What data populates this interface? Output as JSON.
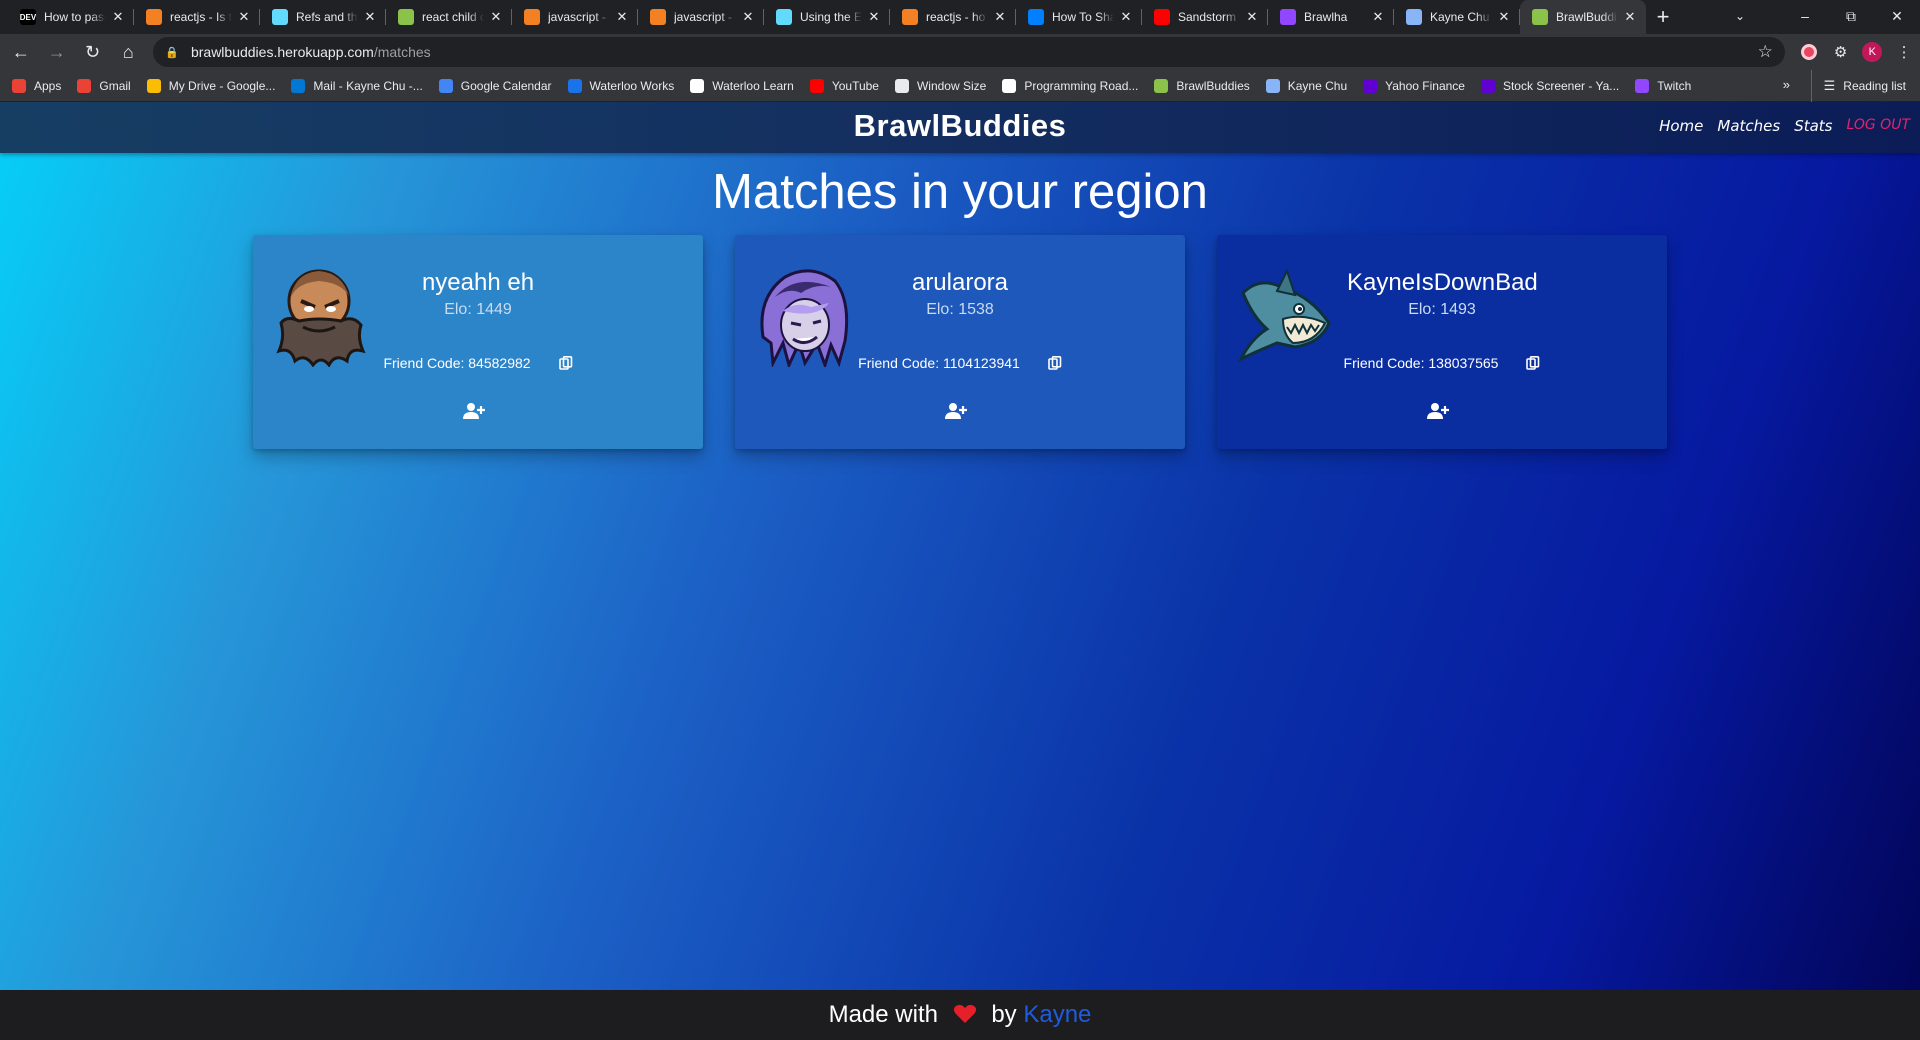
{
  "tabs": [
    {
      "title": "How to pass",
      "favicon": "DEV",
      "color": "#000000",
      "active": false
    },
    {
      "title": "reactjs - Is t",
      "favicon": "stackoverflow-icon",
      "color": "#f48024",
      "active": false
    },
    {
      "title": "Refs and th",
      "favicon": "react-icon",
      "color": "#61dafb",
      "active": false
    },
    {
      "title": "react child c",
      "favicon": "brawl-icon",
      "color": "#8bc34a",
      "active": false
    },
    {
      "title": "javascript - ",
      "favicon": "stackoverflow-icon",
      "color": "#f48024",
      "active": false
    },
    {
      "title": "javascript - ",
      "favicon": "stackoverflow-icon",
      "color": "#f48024",
      "active": false
    },
    {
      "title": "Using the E",
      "favicon": "react-icon",
      "color": "#61dafb",
      "active": false
    },
    {
      "title": "reactjs - ho",
      "favicon": "stackoverflow-icon",
      "color": "#f48024",
      "active": false
    },
    {
      "title": "How To Sha",
      "favicon": "digitalocean-icon",
      "color": "#0080ff",
      "active": false
    },
    {
      "title": "Sandstorm",
      "favicon": "youtube-icon",
      "color": "#ff0000",
      "active": false
    },
    {
      "title": "Brawlha",
      "favicon": "twitch-icon",
      "color": "#9146ff",
      "active": false
    },
    {
      "title": "Kayne Chu",
      "favicon": "globe-icon",
      "color": "#8ab4f8",
      "active": false
    },
    {
      "title": "BrawlBuddi",
      "favicon": "brawl-icon",
      "color": "#8bc34a",
      "active": true
    }
  ],
  "address": {
    "host": "brawlbuddies.herokuapp.com",
    "path": "/matches"
  },
  "profile_initial": "K",
  "bookmarks": [
    {
      "label": "Apps",
      "icon": "apps-grid-icon",
      "color": "#ea4335"
    },
    {
      "label": "Gmail",
      "icon": "gmail-icon",
      "color": "#ea4335"
    },
    {
      "label": "My Drive - Google...",
      "icon": "drive-icon",
      "color": "#fbbc04"
    },
    {
      "label": "Mail - Kayne Chu -...",
      "icon": "outlook-icon",
      "color": "#0078d4"
    },
    {
      "label": "Google Calendar",
      "icon": "calendar-icon",
      "color": "#4285f4"
    },
    {
      "label": "Waterloo Works",
      "icon": "waterloo-works-icon",
      "color": "#1a73e8"
    },
    {
      "label": "Waterloo Learn",
      "icon": "learn-icon",
      "color": "#ffffff"
    },
    {
      "label": "YouTube",
      "icon": "youtube-icon",
      "color": "#ff0000"
    },
    {
      "label": "Window Size",
      "icon": "globe-icon",
      "color": "#e8eaed"
    },
    {
      "label": "Programming Road...",
      "icon": "github-icon",
      "color": "#ffffff"
    },
    {
      "label": "BrawlBuddies",
      "icon": "brawl-icon",
      "color": "#8bc34a"
    },
    {
      "label": "Kayne Chu",
      "icon": "globe-icon",
      "color": "#8ab4f8"
    },
    {
      "label": "Yahoo Finance",
      "icon": "yahoo-icon",
      "color": "#6001d2"
    },
    {
      "label": "Stock Screener - Ya...",
      "icon": "yahoo-icon",
      "color": "#6001d2"
    },
    {
      "label": "Twitch",
      "icon": "twitch-icon",
      "color": "#9146ff"
    }
  ],
  "bookmarks_more": "»",
  "reading_list": "Reading list",
  "site": {
    "brand": "BrawlBuddies",
    "nav": [
      "Home",
      "Matches",
      "Stats"
    ],
    "logout": "LOG OUT",
    "headline": "Matches in your region"
  },
  "matches": [
    {
      "username": "nyeahh eh",
      "elo": "Elo: 1449",
      "friend_code": "Friend Code: 84582982",
      "avatar": "bearded-warrior-avatar",
      "card_color": "#2c84c9"
    },
    {
      "username": "arularora",
      "elo": "Elo: 1538",
      "friend_code": "Friend Code: 1104123941",
      "avatar": "purple-hair-avatar",
      "card_color": "#1e58bb"
    },
    {
      "username": "KayneIsDownBad",
      "elo": "Elo: 1493",
      "friend_code": "Friend Code: 138037565",
      "avatar": "shark-avatar",
      "card_color": "#0a2ea0"
    }
  ],
  "footer": {
    "made_with": "Made with",
    "by": "by",
    "author": "Kayne"
  }
}
